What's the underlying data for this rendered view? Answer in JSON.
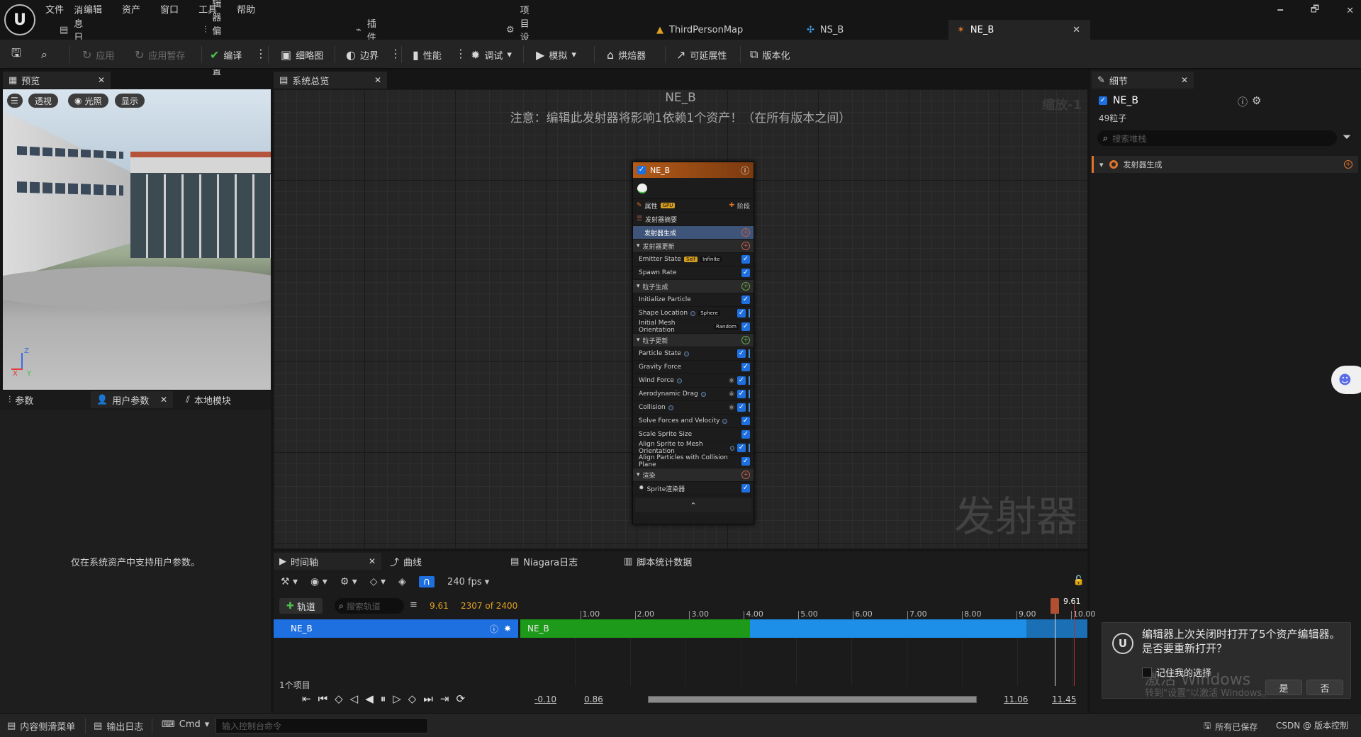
{
  "menu": [
    "文件",
    "编辑",
    "资产",
    "窗口",
    "工具",
    "帮助"
  ],
  "window_controls": [
    "🗕",
    "🗗",
    "✕"
  ],
  "doc_tabs": [
    {
      "label": "消息日志"
    },
    {
      "label": "编辑器偏好设置"
    },
    {
      "label": "插件"
    },
    {
      "label": "项目设置"
    },
    {
      "label": "ThirdPersonMap"
    },
    {
      "label": "NS_B"
    },
    {
      "label": "NE_B",
      "active": true
    }
  ],
  "toolbar": {
    "apply": "应用",
    "apply_stash": "应用暂存",
    "compile": "编译",
    "thumbnail": "细略图",
    "bounds": "边界",
    "performance": "性能",
    "debug": "调试",
    "simulate": "模拟",
    "bake": "烘焙器",
    "scalability": "可延展性",
    "versioning": "版本化"
  },
  "preview": {
    "tab": "预览",
    "perspective": "透视",
    "lit": "光照",
    "show": "显示",
    "axis_x": "X",
    "axis_y": "Y",
    "axis_z": "Z"
  },
  "params_panel": {
    "tabs": [
      "参数",
      "用户参数",
      "本地模块"
    ],
    "message": "仅在系统资产中支持用户参数。"
  },
  "graph": {
    "tab": "系统总览",
    "title": "NE_B",
    "notice": "注意：编辑此发射器将影响1依赖1个资产！（在所有版本之间）",
    "zoom": "缩放-1",
    "watermark": "发射器"
  },
  "node": {
    "name": "NE_B",
    "properties": "属性",
    "gpu": "GPU",
    "stage": "阶段",
    "summary": "发射器摘要",
    "rows": [
      {
        "label": "发射器生成",
        "kind": "selected"
      },
      {
        "label": "发射器更新",
        "kind": "section"
      },
      {
        "label": "Emitter State",
        "tags": [
          "Self",
          "Infinite"
        ]
      },
      {
        "label": "Spawn Rate"
      },
      {
        "label": "粒子生成",
        "kind": "section",
        "green": true
      },
      {
        "label": "Initialize Particle"
      },
      {
        "label": "Shape Location",
        "dot": true,
        "tags": [
          "Sphere"
        ],
        "bar": true
      },
      {
        "label": "Initial Mesh Orientation",
        "tags": [
          "Random"
        ]
      },
      {
        "label": "粒子更新",
        "kind": "section",
        "green": true
      },
      {
        "label": "Particle State",
        "dot": true,
        "bar": true
      },
      {
        "label": "Gravity Force"
      },
      {
        "label": "Wind Force",
        "dot": true,
        "eye": true,
        "bar": true
      },
      {
        "label": "Aerodynamic Drag",
        "dot": true,
        "eye": true,
        "bar": true
      },
      {
        "label": "Collision",
        "dot": true,
        "eye": true,
        "bar": true
      },
      {
        "label": "Solve Forces and Velocity",
        "dot": true
      },
      {
        "label": "Scale Sprite Size"
      },
      {
        "label": "Align Sprite to Mesh Orientation",
        "dot": true,
        "bar": true
      },
      {
        "label": "Align Particles with Collision Plane"
      },
      {
        "label": "渲染",
        "kind": "section"
      },
      {
        "label": "Sprite渲染器",
        "sprite": true
      }
    ]
  },
  "details": {
    "tab": "细节",
    "name": "NE_B",
    "particles": "49粒子",
    "search_placeholder": "搜索堆栈",
    "item": "发射器生成"
  },
  "timeline": {
    "tabs": [
      "时间轴",
      "曲线",
      "Niagara日志",
      "脚本统计数据"
    ],
    "fps": "240 fps",
    "add_track": "轨道",
    "search_placeholder": "搜索轨道",
    "current_time": "9.61",
    "frame": "2307 of 2400",
    "track": "NE_B",
    "ruler": [
      "1.00",
      "2.00",
      "3.00",
      "4.00",
      "5.00",
      "6.00",
      "7.00",
      "8.00",
      "9.00",
      "10.00"
    ],
    "playhead_label": "9.61",
    "items_count": "1个项目",
    "range_start": "-0.10",
    "range_in": "0.86",
    "range_out": "11.06",
    "range_end": "11.45"
  },
  "statusbar": {
    "content_drawer": "内容侧滑菜单",
    "output_log": "输出日志",
    "cmd": "Cmd",
    "console_placeholder": "输入控制台命令",
    "all_saved": "所有已保存",
    "source_control": "版本控制",
    "watermark_text": "CSDN @"
  },
  "notification": {
    "message": "编辑器上次关闭时打开了5个资产编辑器。是否要重新打开？",
    "remember": "记住我的选择",
    "yes": "是",
    "no": "否",
    "activate_title": "激活 Windows",
    "activate_sub": "转到\"设置\"以激活 Windows。"
  },
  "colors": {
    "accent_blue": "#1e6fe0",
    "node_header": "#b35a18",
    "timeline_green": "#1d9a1a",
    "timeline_blue": "#1d8fe8"
  }
}
